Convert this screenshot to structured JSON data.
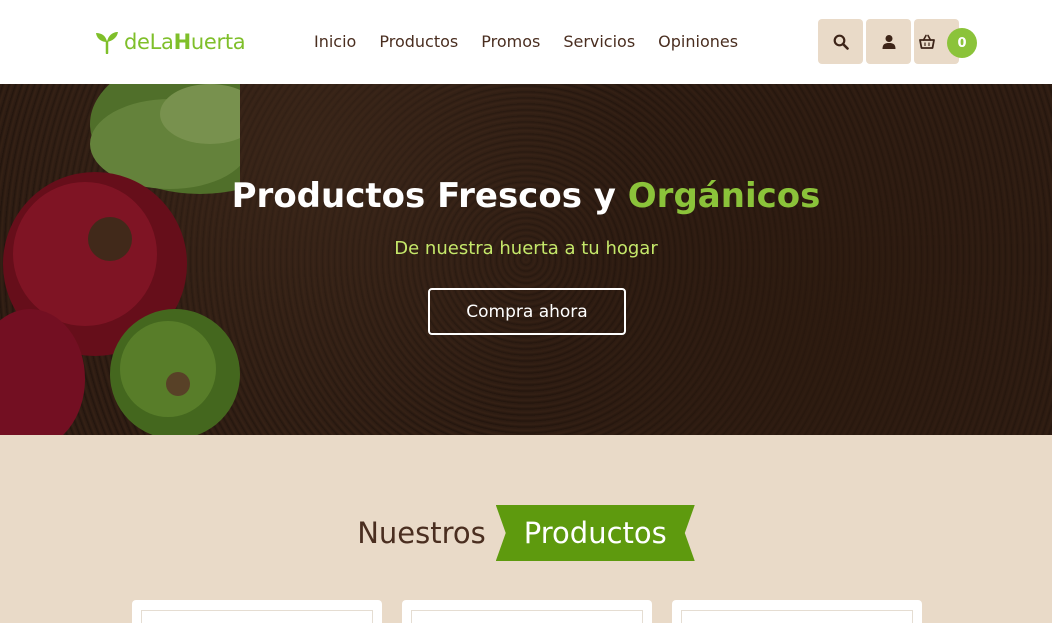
{
  "brand": {
    "prefix": "deLa",
    "bold": "H",
    "suffix": "uerta",
    "logo_icon": "sprout-icon",
    "color": "#7fbf2a"
  },
  "nav": {
    "items": [
      "Inicio",
      "Productos",
      "Promos",
      "Servicios",
      "Opiniones"
    ]
  },
  "header_actions": {
    "search_icon": "search-icon",
    "user_icon": "user-icon",
    "cart_icon": "basket-icon",
    "cart_count": "0"
  },
  "hero": {
    "title_plain": "Productos Frescos y ",
    "title_accent": "Orgánicos",
    "subtitle": "De nuestra huerta a tu hogar",
    "cta_label": "Compra ahora"
  },
  "products_section": {
    "title_plain": "Nuestros",
    "title_highlight": "Productos"
  },
  "colors": {
    "accent": "#8bc33a",
    "ribbon": "#5e9a0e",
    "section_bg": "#e9dac8",
    "text": "#4a2e20"
  }
}
